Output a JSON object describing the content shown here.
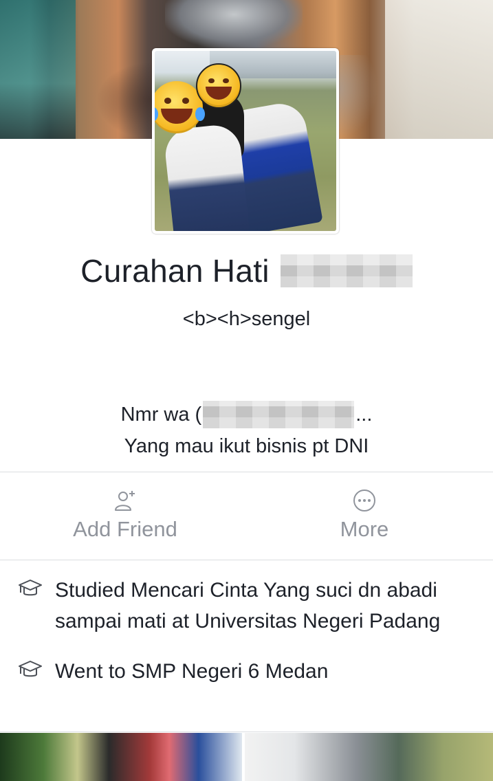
{
  "profile": {
    "name": "Curahan Hati",
    "tagline": "<b><h>sengel",
    "bio_line1_prefix": "Nmr wa (",
    "bio_line1_suffix": "...",
    "bio_line2": "Yang mau ikut bisnis pt DNI"
  },
  "actions": {
    "add_friend_label": "Add Friend",
    "more_label": "More",
    "icons": {
      "add_friend": "add-person-icon",
      "more": "more-dots-icon"
    }
  },
  "info": [
    {
      "icon": "graduation-cap-icon",
      "text": "Studied Mencari Cinta Yang suci dn abadi sampai mati at Universitas Negeri Padang"
    },
    {
      "icon": "graduation-cap-icon",
      "text": "Went to SMP Negeri 6 Medan"
    }
  ],
  "colors": {
    "text_primary": "#1d2129",
    "text_secondary": "#90949c",
    "divider": "#dadde1",
    "background": "#ffffff"
  }
}
